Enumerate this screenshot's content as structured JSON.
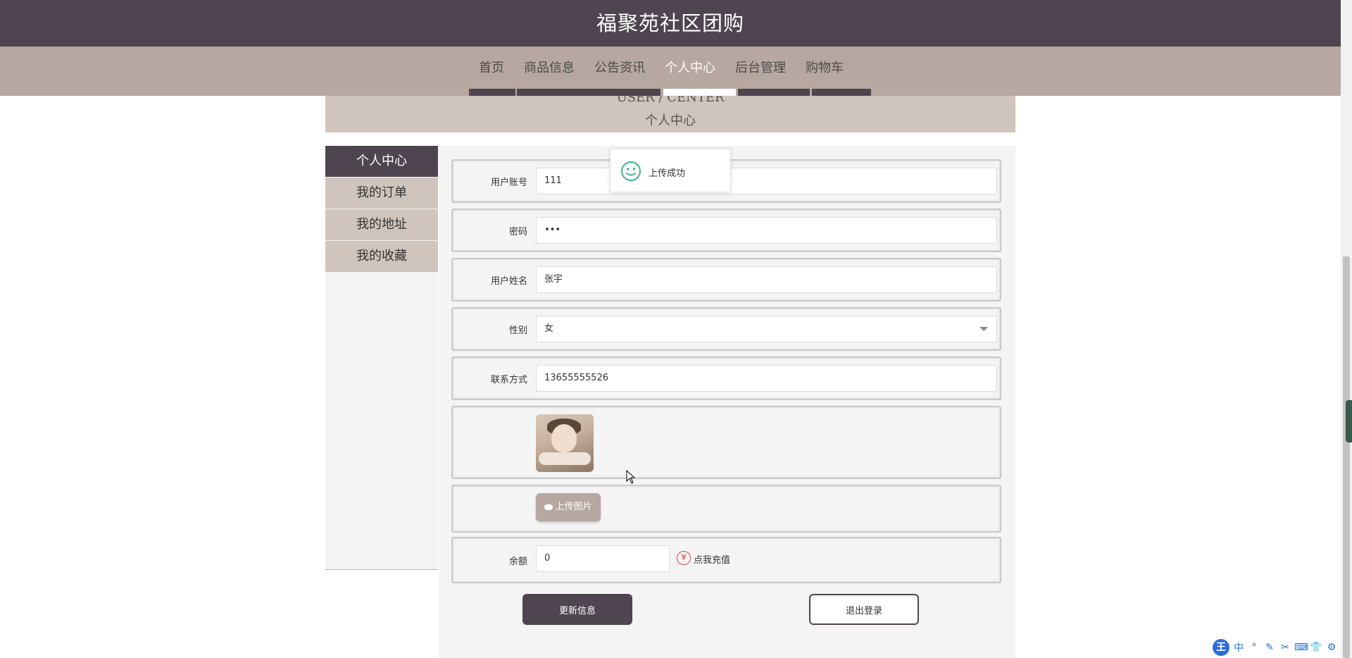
{
  "header": {
    "title": "福聚苑社区团购"
  },
  "nav": {
    "items": [
      {
        "label": "首页"
      },
      {
        "label": "商品信息"
      },
      {
        "label": "公告资讯"
      },
      {
        "label": "个人中心"
      },
      {
        "label": "后台管理"
      },
      {
        "label": "购物车"
      }
    ],
    "active": "个人中心"
  },
  "banner": {
    "en": "USER / CENTER",
    "cn": "个人中心"
  },
  "sidebar": {
    "items": [
      {
        "label": "个人中心"
      },
      {
        "label": "我的订单"
      },
      {
        "label": "我的地址"
      },
      {
        "label": "我的收藏"
      }
    ]
  },
  "form": {
    "account": {
      "label": "用户账号",
      "value": "111"
    },
    "password": {
      "label": "密码",
      "value": "•••"
    },
    "name": {
      "label": "用户姓名",
      "value": "张宇"
    },
    "gender": {
      "label": "性别",
      "value": "女"
    },
    "phone": {
      "label": "联系方式",
      "value": "13655555526"
    },
    "upload_label": "上传图片",
    "balance": {
      "label": "余额",
      "value": "0",
      "recharge": "点我充值",
      "yen": "¥"
    },
    "update_button": "更新信息",
    "logout_button": "退出登录"
  },
  "toast": {
    "text": "上传成功"
  },
  "ime": {
    "logo": "王",
    "items": [
      "中",
      "°",
      "✎",
      "✂",
      "⌨",
      "👕",
      "⚙"
    ]
  },
  "colors": {
    "header": "#4e4550",
    "nav": "#b6a8a0",
    "banner": "#cfc5bc",
    "toast_icon": "#3fb58e"
  }
}
